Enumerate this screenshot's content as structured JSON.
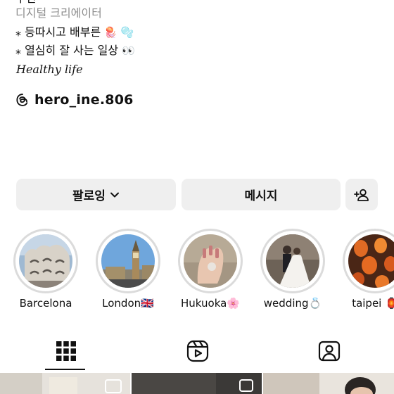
{
  "profile": {
    "name_cut": "우인",
    "category": "디지털 크리에이터",
    "bio_line1_text": "⁎ 등따시고 배부른",
    "bio_line1_emoji": "🪼 🫧",
    "bio_line2_text": "⁎ 열심히 잘 사는 일상",
    "bio_line2_emoji": "👀",
    "bio_line3": "Healthy life",
    "threads_handle": "hero_ine.806"
  },
  "buttons": {
    "follow_label": "팔로잉",
    "message_label": "메시지"
  },
  "highlights": [
    {
      "label": "Barcelona"
    },
    {
      "label": "London🇬🇧"
    },
    {
      "label": "Hukuoka🌸"
    },
    {
      "label": "wedding💍"
    },
    {
      "label": "taipei 🏮"
    }
  ],
  "tabs": [
    {
      "icon": "grid-icon",
      "selected": true
    },
    {
      "icon": "reels-icon",
      "selected": false
    },
    {
      "icon": "tagged-icon",
      "selected": false
    }
  ],
  "colors": {
    "button_bg": "#efefef",
    "secondary_text": "#8e8e8e",
    "ring": "#dbdbdb",
    "text": "#111111"
  }
}
